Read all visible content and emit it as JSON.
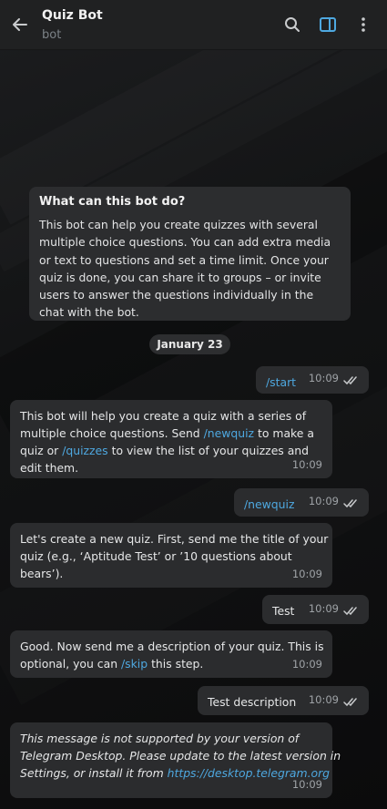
{
  "header": {
    "title": "Quiz Bot",
    "subtitle": "bot",
    "icons": [
      "back-arrow-icon",
      "search-icon",
      "sidebar-panel-icon",
      "more-vert-icon"
    ],
    "accent": "#4ea8e0"
  },
  "info_card": {
    "heading": "What can this bot do?",
    "lines": [
      "This bot can help you create quizzes with several",
      "multiple choice questions. You can add extra media or",
      "text to questions and set a time limit. Once your quiz",
      "is done, you can share it to groups – or invite users to",
      "answer the questions individually in the chat with the",
      "bot."
    ]
  },
  "date_label": "January 23",
  "messages": [
    {
      "dir": "out",
      "text": "/start",
      "time": "10:09"
    },
    {
      "dir": "in",
      "l1": "This bot will help you create a quiz with a series of",
      "l2a": "multiple choice questions. Send ",
      "l2link": "/newquiz",
      "l2b": " to make a",
      "l3a": "quiz or ",
      "l3link": "/quizzes",
      "l3b": " to view the list of your quizzes and",
      "l4": "edit them.",
      "time": "10:09"
    },
    {
      "dir": "out",
      "text": "/newquiz",
      "time": "10:09"
    },
    {
      "dir": "in",
      "l1": "Let's create a new quiz. First, send me the title of your",
      "l2": "quiz (e.g., ‘Aptitude Test’ or ’10 questions about",
      "l3": "bears’).",
      "time": "10:09"
    },
    {
      "dir": "out",
      "text": "Test",
      "time": "10:09"
    },
    {
      "dir": "in",
      "l1": "Good. Now send me a description of your quiz. This is",
      "l2a": "optional, you can ",
      "l2link": "/skip",
      "l2b": " this step.",
      "time": "10:09"
    },
    {
      "dir": "out",
      "text": "Test description",
      "time": "10:09"
    },
    {
      "dir": "in",
      "l1": "This message is not supported by your version of",
      "l2": "Telegram Desktop. Please update to the latest version in",
      "l3a": "Settings, or install it from ",
      "l3link": "https://desktop.telegram.org",
      "time": "10:09"
    }
  ]
}
